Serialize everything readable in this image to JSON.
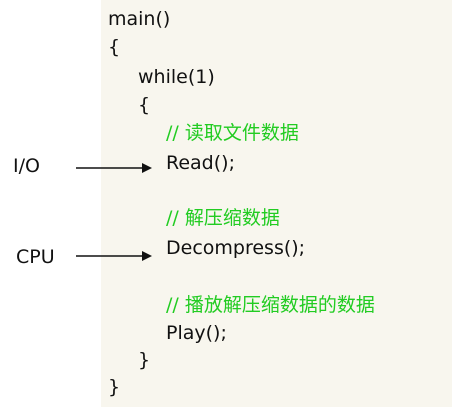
{
  "code": {
    "lines": [
      "main()",
      "{",
      "while(1)",
      "{",
      "// 读取文件数据",
      "Read();",
      "// 解压缩数据",
      "Decompress();",
      "// 播放解压缩数据的数据",
      "Play();",
      "}",
      "}"
    ]
  },
  "labels": {
    "io": "I/O",
    "cpu": "CPU"
  },
  "colors": {
    "comment": "#22cc22",
    "code": "#111111",
    "panel_background": "#f8f6ee"
  }
}
